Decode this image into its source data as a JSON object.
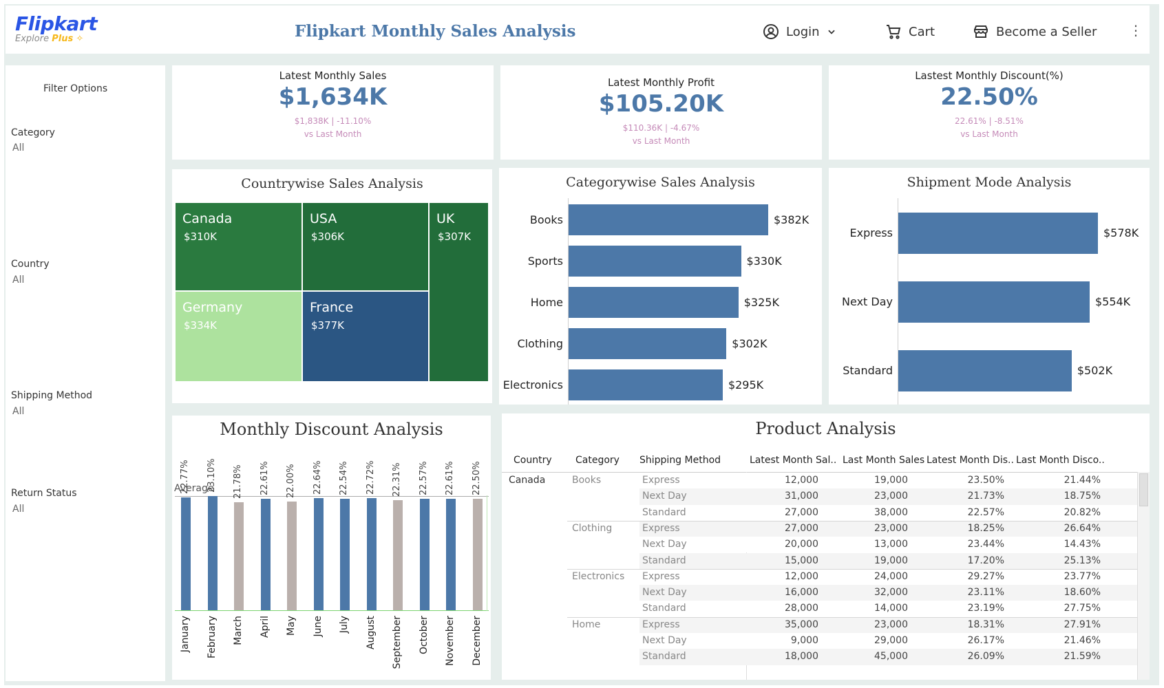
{
  "header": {
    "logo_text": "Flipkart",
    "logo_sub_a": "Explore",
    "logo_sub_b": "Plus",
    "title": "Flipkart Monthly  Sales Analysis",
    "login": "Login",
    "cart": "Cart",
    "seller": "Become a Seller",
    "icons": {
      "login": "user-circle-icon",
      "cart": "cart-icon",
      "seller": "store-icon",
      "more": "kebab-icon"
    }
  },
  "sidebar": {
    "title": "Filter Options",
    "filters": [
      {
        "label": "Category",
        "value": "All"
      },
      {
        "label": "Country",
        "value": "All"
      },
      {
        "label": "Shipping Method",
        "value": "All"
      },
      {
        "label": "Return Status",
        "value": "All"
      }
    ]
  },
  "kpis": [
    {
      "label": "Latest Monthly Sales",
      "value": "$1,634K",
      "sub": "$1,838K  |  -11.10%",
      "vs": "vs Last Month"
    },
    {
      "label": "Latest Monthly Profit",
      "value": "$105.20K",
      "sub": "$110.36K  |  -4.67%",
      "vs": "vs Last Month"
    },
    {
      "label": "Lastest Monthly Discount(%)",
      "value": "22.50%",
      "sub": "22.61%  |  -8.51%",
      "vs": "vs Last Month"
    }
  ],
  "colors": {
    "accent": "#4c78a8",
    "kpi_sub": "#c58ab8",
    "dark_green": "#226d3a",
    "mid_green": "#2a7a3f",
    "light_green": "#ade29e",
    "dark_blue": "#2b5683",
    "gray_bar": "#bab0ac"
  },
  "country": {
    "title": "Countrywise Sales  Analysis",
    "cells": [
      {
        "name": "Canada",
        "value": "$310K"
      },
      {
        "name": "USA",
        "value": "$306K"
      },
      {
        "name": "UK",
        "value": "$307K"
      },
      {
        "name": "Germany",
        "value": "$334K"
      },
      {
        "name": "France",
        "value": "$377K"
      }
    ]
  },
  "chart_data": [
    {
      "type": "bar",
      "title": "Categorywise Sales Analysis",
      "categories": [
        "Books",
        "Sports",
        "Home",
        "Clothing",
        "Electronics"
      ],
      "values": [
        382,
        330,
        325,
        302,
        295
      ],
      "labels": [
        "$382K",
        "$330K",
        "$325K",
        "$302K",
        "$295K"
      ],
      "orientation": "horizontal"
    },
    {
      "type": "bar",
      "title": "Shipment Mode Analysis",
      "categories": [
        "Express",
        "Next Day",
        "Standard"
      ],
      "values": [
        578,
        554,
        502
      ],
      "labels": [
        "$578K",
        "$554K",
        "$502K"
      ],
      "orientation": "horizontal"
    },
    {
      "type": "bar",
      "title": "Monthly Discount Analysis",
      "categories": [
        "January",
        "February",
        "March",
        "April",
        "May",
        "June",
        "July",
        "August",
        "September",
        "October",
        "November",
        "December"
      ],
      "values": [
        22.77,
        23.1,
        21.78,
        22.61,
        22.0,
        22.64,
        22.54,
        22.72,
        22.31,
        22.57,
        22.61,
        22.5
      ],
      "labels": [
        "22.77%",
        "23.10%",
        "21.78%",
        "22.61%",
        "22.00%",
        "22.64%",
        "22.54%",
        "22.72%",
        "22.31%",
        "22.57%",
        "22.61%",
        "22.50%"
      ],
      "above_average": [
        true,
        true,
        false,
        true,
        false,
        true,
        true,
        true,
        false,
        true,
        true,
        false
      ],
      "reference_line": "Average",
      "orientation": "vertical"
    }
  ],
  "product": {
    "title": "Product Analysis",
    "columns": [
      "Country",
      "Category",
      "Shipping Method",
      "Latest Month Sal..",
      "Last Month Sales",
      "Latest Month Dis..",
      "Last Month Disco.."
    ],
    "country": "Canada",
    "rows": [
      {
        "category": "Books",
        "method": "Express",
        "lm_sales": "12,000",
        "prev_sales": "19,000",
        "lm_disc": "23.50%",
        "prev_disc": "21.44%"
      },
      {
        "category": "",
        "method": "Next Day",
        "lm_sales": "31,000",
        "prev_sales": "23,000",
        "lm_disc": "21.73%",
        "prev_disc": "18.75%"
      },
      {
        "category": "",
        "method": "Standard",
        "lm_sales": "27,000",
        "prev_sales": "38,000",
        "lm_disc": "22.57%",
        "prev_disc": "20.82%"
      },
      {
        "category": "Clothing",
        "method": "Express",
        "lm_sales": "27,000",
        "prev_sales": "23,000",
        "lm_disc": "18.25%",
        "prev_disc": "26.64%"
      },
      {
        "category": "",
        "method": "Next Day",
        "lm_sales": "20,000",
        "prev_sales": "13,000",
        "lm_disc": "23.44%",
        "prev_disc": "14.43%"
      },
      {
        "category": "",
        "method": "Standard",
        "lm_sales": "15,000",
        "prev_sales": "19,000",
        "lm_disc": "17.20%",
        "prev_disc": "25.13%"
      },
      {
        "category": "Electronics",
        "method": "Express",
        "lm_sales": "12,000",
        "prev_sales": "24,000",
        "lm_disc": "29.27%",
        "prev_disc": "23.77%"
      },
      {
        "category": "",
        "method": "Next Day",
        "lm_sales": "16,000",
        "prev_sales": "32,000",
        "lm_disc": "23.11%",
        "prev_disc": "18.60%"
      },
      {
        "category": "",
        "method": "Standard",
        "lm_sales": "28,000",
        "prev_sales": "14,000",
        "lm_disc": "23.19%",
        "prev_disc": "27.75%"
      },
      {
        "category": "Home",
        "method": "Express",
        "lm_sales": "35,000",
        "prev_sales": "23,000",
        "lm_disc": "18.31%",
        "prev_disc": "27.91%"
      },
      {
        "category": "",
        "method": "Next Day",
        "lm_sales": "9,000",
        "prev_sales": "29,000",
        "lm_disc": "26.17%",
        "prev_disc": "21.46%"
      },
      {
        "category": "",
        "method": "Standard",
        "lm_sales": "18,000",
        "prev_sales": "45,000",
        "lm_disc": "26.09%",
        "prev_disc": "21.59%"
      }
    ]
  }
}
